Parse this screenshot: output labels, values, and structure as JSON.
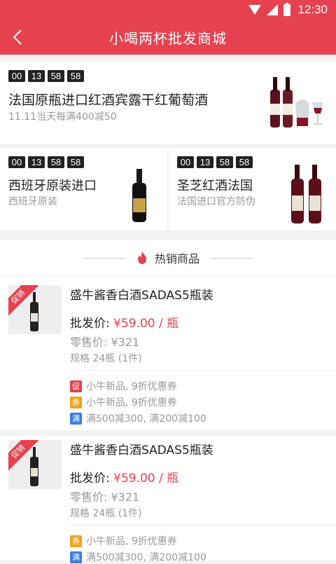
{
  "status_bar": {
    "time": "12:30"
  },
  "header": {
    "title": "小喝两杯批发商城"
  },
  "flash_main": {
    "timer": [
      "00",
      "13",
      "58",
      "58"
    ],
    "title": "法国原瓶进口红酒宾露干红葡萄酒",
    "subtitle": "11.11当天每满400减50"
  },
  "flash_left": {
    "timer": [
      "00",
      "13",
      "58",
      "58"
    ],
    "title": "西班牙原装进口",
    "subtitle": "西班牙原装"
  },
  "flash_right": {
    "timer": [
      "00",
      "13",
      "58",
      "58"
    ],
    "title": "圣芝红酒法国",
    "subtitle": "法国进口官方防伪"
  },
  "hot": {
    "title": "热销商品"
  },
  "products": [
    {
      "tag": "促销",
      "name": "盛牛酱香白酒SADAS5瓶装",
      "wholesale_label": "批发价:",
      "wholesale_price": "¥59.00 / 瓶",
      "retail": "零售价: ¥321",
      "spec": "规格  24瓶 (1件)",
      "promos": [
        {
          "badge": "促",
          "text": "小牛新品, 9折优惠券"
        },
        {
          "badge": "券",
          "text": "小牛新品, 9折优惠券"
        },
        {
          "badge": "满",
          "text": "满500减300, 满200减100"
        }
      ]
    },
    {
      "tag": "促销",
      "name": "盛牛酱香白酒SADAS5瓶装",
      "wholesale_label": "批发价:",
      "wholesale_price": "¥59.00 / 瓶",
      "retail": "零售价: ¥321",
      "spec": "规格  24瓶 (1件)",
      "promos": [
        {
          "badge": "券",
          "text": "小牛新品, 9折优惠券"
        },
        {
          "badge": "满",
          "text": "满500减300, 满200减100"
        }
      ]
    }
  ],
  "colors": {
    "brand": "#e5414f",
    "coupon": "#f4a21c",
    "discount": "#3a7ee4"
  }
}
